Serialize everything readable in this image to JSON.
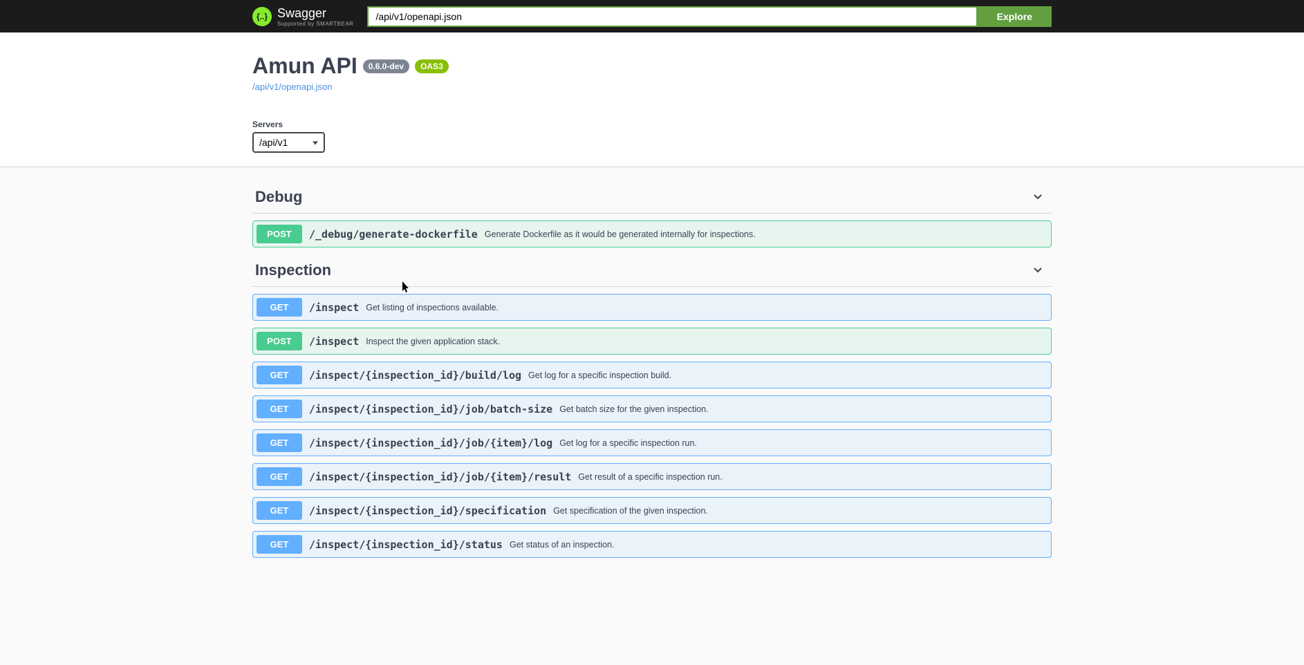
{
  "topbar": {
    "logo_text": "Swagger",
    "logo_sub": "Supported by SMARTBEAR",
    "url_value": "/api/v1/openapi.json",
    "explore_label": "Explore"
  },
  "info": {
    "title": "Amun API",
    "version": "0.6.0-dev",
    "oas": "OAS3",
    "spec_url": "/api/v1/openapi.json"
  },
  "servers": {
    "label": "Servers",
    "selected": "/api/v1"
  },
  "tags": [
    {
      "name": "Debug",
      "operations": [
        {
          "method": "POST",
          "path": "/_debug/generate-dockerfile",
          "desc": "Generate Dockerfile as it would be generated internally for inspections."
        }
      ]
    },
    {
      "name": "Inspection",
      "operations": [
        {
          "method": "GET",
          "path": "/inspect",
          "desc": "Get listing of inspections available."
        },
        {
          "method": "POST",
          "path": "/inspect",
          "desc": "Inspect the given application stack."
        },
        {
          "method": "GET",
          "path": "/inspect/{inspection_id}/build/log",
          "desc": "Get log for a specific inspection build."
        },
        {
          "method": "GET",
          "path": "/inspect/{inspection_id}/job/batch-size",
          "desc": "Get batch size for the given inspection."
        },
        {
          "method": "GET",
          "path": "/inspect/{inspection_id}/job/{item}/log",
          "desc": "Get log for a specific inspection run."
        },
        {
          "method": "GET",
          "path": "/inspect/{inspection_id}/job/{item}/result",
          "desc": "Get result of a specific inspection run."
        },
        {
          "method": "GET",
          "path": "/inspect/{inspection_id}/specification",
          "desc": "Get specification of the given inspection."
        },
        {
          "method": "GET",
          "path": "/inspect/{inspection_id}/status",
          "desc": "Get status of an inspection."
        }
      ]
    }
  ]
}
